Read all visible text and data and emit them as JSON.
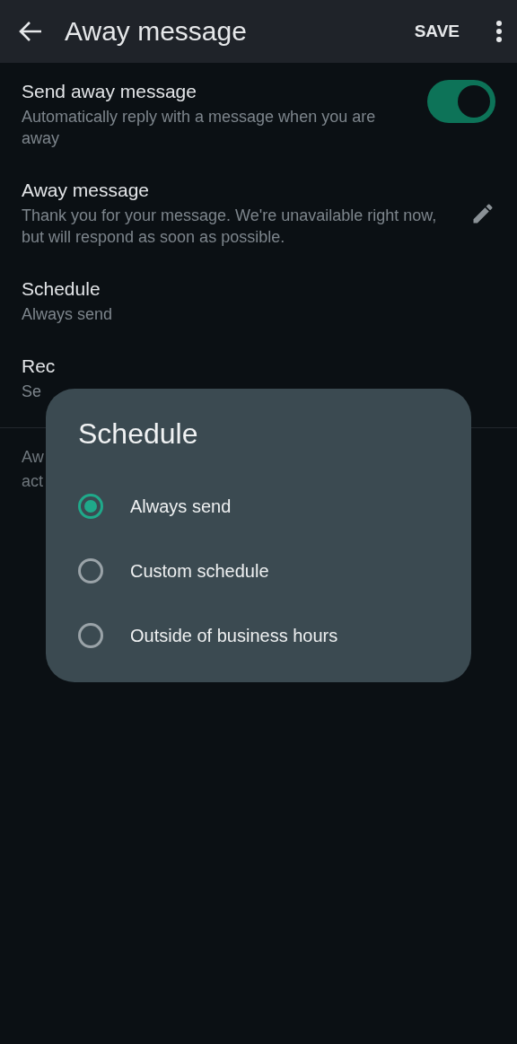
{
  "app_bar": {
    "title": "Away message",
    "action": "SAVE"
  },
  "settings": [
    {
      "kind": "switch",
      "title": "Send away message",
      "subtitle": "Automatically reply with a message when you are away",
      "on": true
    },
    {
      "kind": "edit",
      "title": "Away message",
      "subtitle": "Thank you for your message. We're unavailable right now, but will respond as soon as possible."
    },
    {
      "kind": "plain",
      "title": "Schedule",
      "subtitle": "Always send"
    },
    {
      "kind": "plain",
      "title": "Rec",
      "subtitle": "Se"
    }
  ],
  "footer_note": [
    "Aw",
    "act"
  ],
  "dialog": {
    "title": "Schedule",
    "options": [
      {
        "label": "Always send",
        "selected": true
      },
      {
        "label": "Custom schedule",
        "selected": false
      },
      {
        "label": "Outside of business hours",
        "selected": false
      }
    ]
  }
}
